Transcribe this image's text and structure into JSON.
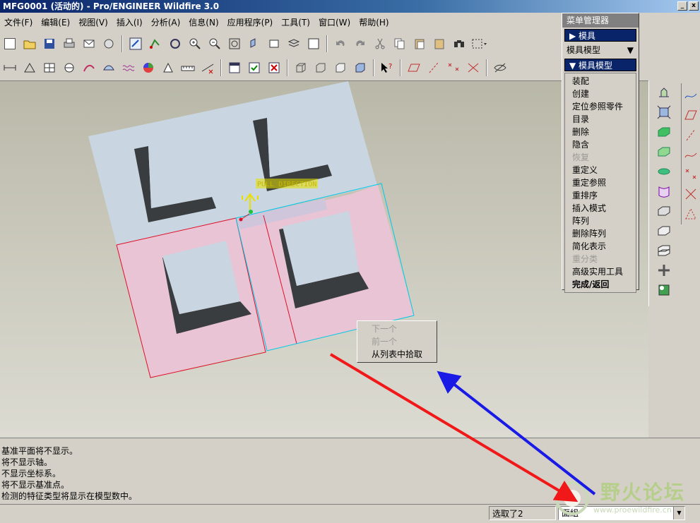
{
  "window": {
    "title": "MFG0001 (活动的) - Pro/ENGINEER Wildfire 3.0",
    "min_glyph": "_",
    "close_glyph": "x"
  },
  "menubar": [
    {
      "label": "文件(F)"
    },
    {
      "label": "编辑(E)"
    },
    {
      "label": "视图(V)"
    },
    {
      "label": "插入(I)"
    },
    {
      "label": "分析(A)"
    },
    {
      "label": "信息(N)"
    },
    {
      "label": "应用程序(P)"
    },
    {
      "label": "工具(T)"
    },
    {
      "label": "窗口(W)"
    },
    {
      "label": "帮助(H)"
    }
  ],
  "graphics": {
    "pull_direction_label": "PULL DIRECTION"
  },
  "menu_manager": {
    "title": "菜单管理器",
    "mold_header": "模具",
    "dropdown_value": "模具模型",
    "model_header": "模具模型",
    "items": [
      {
        "label": "装配",
        "disabled": false,
        "bold": false
      },
      {
        "label": "创建",
        "disabled": false,
        "bold": false
      },
      {
        "label": "定位参照零件",
        "disabled": false,
        "bold": false
      },
      {
        "label": "目录",
        "disabled": false,
        "bold": false
      },
      {
        "label": "删除",
        "disabled": false,
        "bold": false
      },
      {
        "label": "隐含",
        "disabled": false,
        "bold": false
      },
      {
        "label": "恢复",
        "disabled": true,
        "bold": false
      },
      {
        "label": "重定义",
        "disabled": false,
        "bold": false
      },
      {
        "label": "重定参照",
        "disabled": false,
        "bold": false
      },
      {
        "label": "重排序",
        "disabled": false,
        "bold": false
      },
      {
        "label": "插入模式",
        "disabled": false,
        "bold": false
      },
      {
        "label": "阵列",
        "disabled": false,
        "bold": false
      },
      {
        "label": "删除阵列",
        "disabled": false,
        "bold": false
      },
      {
        "label": "简化表示",
        "disabled": false,
        "bold": false
      },
      {
        "label": "重分类",
        "disabled": true,
        "bold": false
      },
      {
        "label": "高级实用工具",
        "disabled": false,
        "bold": false
      },
      {
        "label": "完成/返回",
        "disabled": false,
        "bold": true
      }
    ]
  },
  "context_menu": {
    "items": [
      {
        "label": "下一个",
        "disabled": true
      },
      {
        "label": "前一个",
        "disabled": true
      },
      {
        "label": "从列表中拾取",
        "disabled": false
      }
    ]
  },
  "messages": [
    "基准平面将不显示。",
    "将不显示轴。",
    "不显示坐标系。",
    "将不显示基准点。",
    "检测的特征类型将显示在模型数中。"
  ],
  "status": {
    "selected": "选取了2",
    "filter_value": "面組"
  },
  "watermark": {
    "text": "野火论坛",
    "url": "www.proewildfire.cn"
  },
  "colors": {
    "title_active": "#0a246a",
    "selection_red": "#e0102a",
    "selection_cyan": "#00c8e6",
    "pink_surface": "#e8c4d4",
    "part_face": "#c9d6e1",
    "arrow_red": "#f01818",
    "arrow_blue": "#1a1ae6"
  }
}
